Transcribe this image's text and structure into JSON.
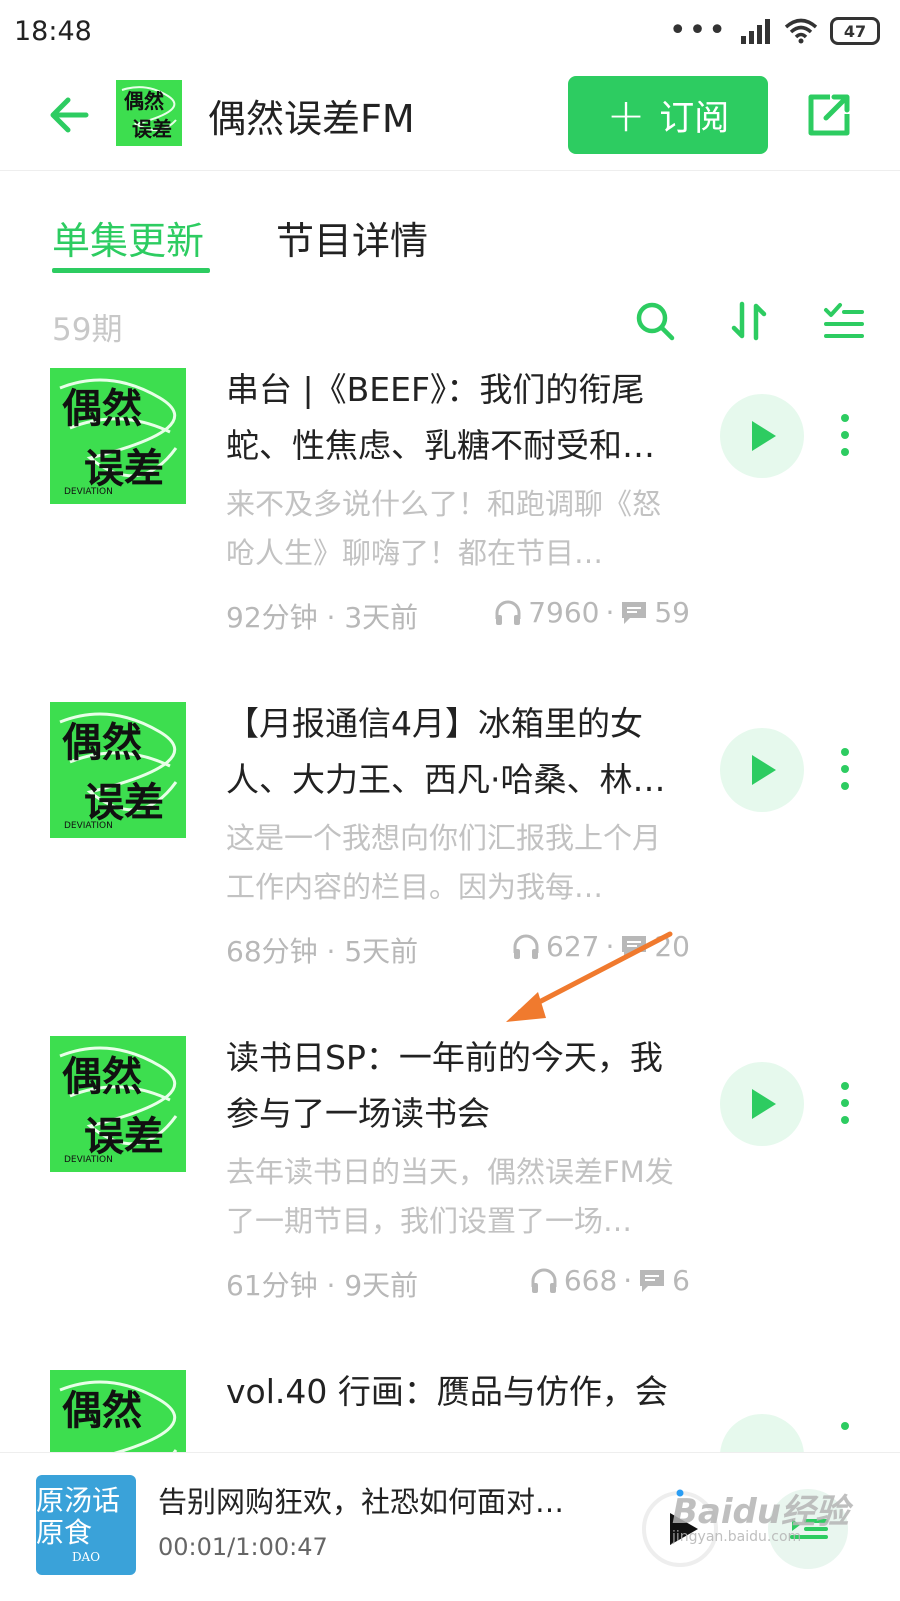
{
  "status_bar": {
    "time": "18:48",
    "battery": "47"
  },
  "header": {
    "podcast_title": "偶然误差FM",
    "subscribe_label": "订阅"
  },
  "tabs": [
    {
      "label": "单集更新"
    },
    {
      "label": "节目详情"
    }
  ],
  "list": {
    "episode_count": "59期"
  },
  "episodes": [
    {
      "title": "串台 |《BEEF》：我们的衔尾蛇、性焦虑、乳糖不耐受和…",
      "description": "来不及多说什么了！和跑调聊《怒呛人生》聊嗨了！都在节目…",
      "duration_age": "92分钟 · 3天前",
      "plays": "7960",
      "comments": "59"
    },
    {
      "title": "【月报通信4月】冰箱里的女人、大力王、西凡·哈桑、林…",
      "description": "这是一个我想向你们汇报我上个月工作内容的栏目。因为我每…",
      "duration_age": "68分钟 · 5天前",
      "plays": "627",
      "comments": "20"
    },
    {
      "title": "读书日SP：一年前的今天，我参与了一场读书会",
      "description": "去年读书日的当天，偶然误差FM发了一期节目，我们设置了一场…",
      "duration_age": "61分钟 · 9天前",
      "plays": "668",
      "comments": "6"
    },
    {
      "title": "vol.40 行画：赝品与仿作，会",
      "description": "",
      "duration_age": "",
      "plays": "",
      "comments": ""
    }
  ],
  "player": {
    "title": "告别网购狂欢，社恐如何面对…",
    "time": "00:01/1:00:47",
    "cover_text": "原汤话原食",
    "cover_sub": "DAO"
  },
  "cover_art": {
    "line1": "偶然",
    "line2": "误差",
    "tag": "DEVIATION"
  },
  "watermark": {
    "brand": "Baidu经验",
    "url": "jingyan.baidu.com"
  },
  "colors": {
    "accent": "#2dcc61",
    "annotation": "#f07a2e"
  }
}
